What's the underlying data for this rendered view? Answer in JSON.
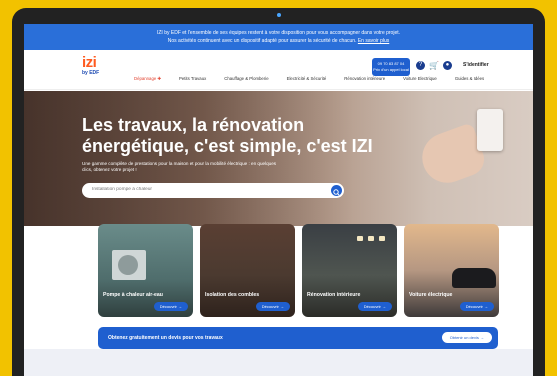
{
  "banner": {
    "line1": "IZI by EDF et l'ensemble de ses équipes restent à votre disposition pour vous accompagner dans votre projet.",
    "line2": "Nos activités continuent avec un dispositif adapté pour assurer la sécurité de chacun.",
    "link": "En savoir plus"
  },
  "logo": {
    "brand": "izi",
    "sub": "by EDF"
  },
  "nav": {
    "items": [
      "Dépannage ✚",
      "Petits Travaux",
      "Chauffage & Plomberie",
      "Electricité & Sécurité",
      "Rénovation intérieure",
      "Voiture Electrique",
      "Guides & Idées"
    ]
  },
  "phone": {
    "number": "09 70 83 87 04",
    "note": "Prix d'un appel local"
  },
  "header": {
    "login": "S'identifier"
  },
  "hero": {
    "title": "Les travaux, la rénovation énergétique, c'est simple, c'est IZI",
    "subtitle": "Une gamme complète de prestations pour la maison et pour la mobilité électrique : en quelques clics, obtenez votre projet !",
    "search_placeholder": "Installation pompe à chaleur"
  },
  "cards": [
    {
      "title": "Pompe à chaleur air-eau",
      "button": "Découvrir →"
    },
    {
      "title": "Isolation des combles",
      "button": "Découvrir →"
    },
    {
      "title": "Rénovation intérieure",
      "button": "Découvrir →"
    },
    {
      "title": "Voiture électrique",
      "button": "Découvrir →"
    }
  ],
  "cta": {
    "text": "Obtenez gratuitement un devis pour vos travaux",
    "button": "Obtenir un devis →"
  },
  "colors": {
    "primary": "#1f5fcf",
    "brand": "#ff5a1f",
    "frame": "#f2c200"
  },
  "icons": [
    "search-icon",
    "help-icon",
    "cart-icon",
    "user-icon",
    "phone-icon"
  ]
}
